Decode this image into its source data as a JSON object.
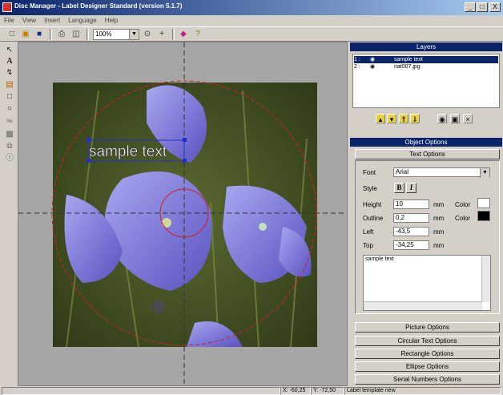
{
  "window": {
    "title": "Disc Manager - Label Designer Standard  (version 5.1.7)",
    "min_label": "_",
    "max_label": "□",
    "close_label": "X"
  },
  "menu": [
    "File",
    "View",
    "Insert",
    "Language",
    "Help"
  ],
  "toolbar": {
    "zoom_value": "100%",
    "icons": [
      "new-icon",
      "open-icon",
      "save-icon",
      "print-icon",
      "print-preview-icon",
      "zoom-fit-icon",
      "crosshair-icon",
      "layers-tool-icon",
      "help-icon"
    ]
  },
  "tools": [
    "select-arrow-icon",
    "text-tool-icon",
    "circular-text-icon",
    "picture-tool-icon",
    "rectangle-tool-icon",
    "ellipse-tool-icon",
    "serial-number-icon",
    "fill-icon",
    "copy-icon",
    "info-icon"
  ],
  "canvas": {
    "sample_text": "sample text",
    "image_name": "nat007.jpg"
  },
  "layers": {
    "header": "Layers",
    "items": [
      {
        "index": "1 :",
        "name": "sample text",
        "selected": true
      },
      {
        "index": "2 :",
        "name": "nat007.jpg",
        "selected": false
      }
    ]
  },
  "object_options": {
    "header": "Object Options",
    "text_options_label": "Text Options",
    "font_label": "Font",
    "font_value": "Arial",
    "style_label": "Style",
    "bold_label": "B",
    "italic_label": "I",
    "height_label": "Height",
    "height_value": "10",
    "outline_label": "Outline",
    "outline_value": "0,2",
    "left_label": "Left",
    "left_value": "-43,5",
    "top_label": "Top",
    "top_value": "-34,25",
    "unit": "mm",
    "color_label": "Color",
    "color1": "#ffffff",
    "color2": "#000000",
    "text_value": "sample text",
    "sections": [
      "Picture Options",
      "Circular Text Options",
      "Rectangle Options",
      "Ellipse Options",
      "Serial Numbers Options"
    ]
  },
  "status": {
    "x": "X: -60,25",
    "y": "Y: -72,50",
    "template": "Label template new"
  }
}
